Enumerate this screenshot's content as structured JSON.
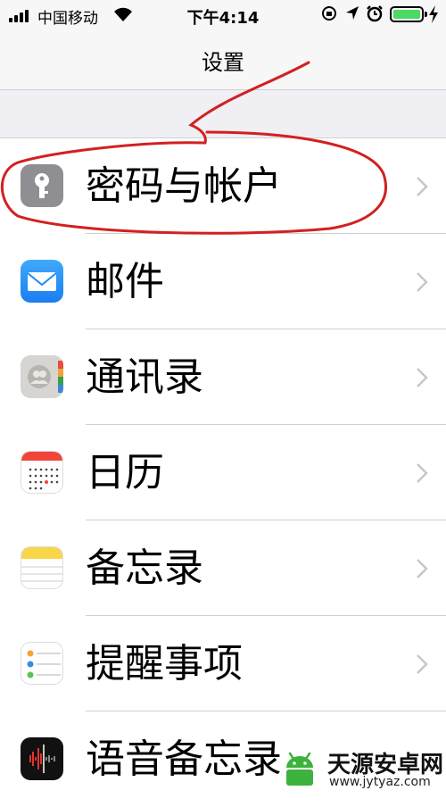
{
  "status_bar": {
    "carrier": "中国移动",
    "time": "下午4:14"
  },
  "nav": {
    "title": "设置"
  },
  "settings_items": [
    {
      "label": "密码与帐户",
      "icon": "key-icon"
    },
    {
      "label": "邮件",
      "icon": "mail-icon"
    },
    {
      "label": "通讯录",
      "icon": "contacts-icon"
    },
    {
      "label": "日历",
      "icon": "calendar-icon"
    },
    {
      "label": "备忘录",
      "icon": "notes-icon"
    },
    {
      "label": "提醒事项",
      "icon": "reminders-icon"
    },
    {
      "label": "语音备忘录",
      "icon": "voice-memos-icon"
    }
  ],
  "watermark": {
    "name": "天源安卓网",
    "url": "www.jytyaz.com"
  },
  "colors": {
    "battery": "#4cd964",
    "mail": "#1a8cf5",
    "annotation": "#d22020",
    "watermark_green": "#3cb33c"
  }
}
